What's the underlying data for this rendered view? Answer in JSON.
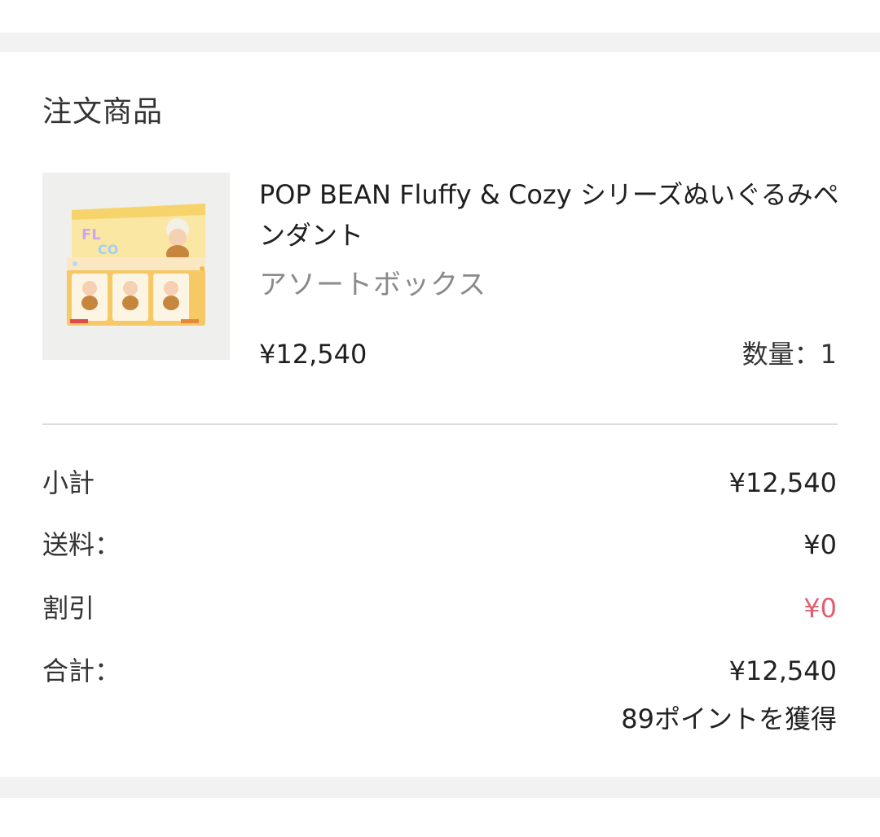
{
  "order": {
    "section_title": "注文商品",
    "item": {
      "name": "POP BEAN Fluffy & Cozy シリーズぬいぐるみペンダント",
      "variant": "アソートボックス",
      "price": "¥12,540",
      "quantity_label": "数量：1"
    }
  },
  "summary": {
    "subtotal_label": "小計",
    "subtotal_value": "¥12,540",
    "shipping_label": "送料：",
    "shipping_value": "¥0",
    "discount_label": "割引",
    "discount_value": "¥0",
    "total_label": "合計：",
    "total_value": "¥12,540",
    "points_text": "89ポイントを獲得"
  },
  "colors": {
    "discount": "#e35d6e",
    "divider": "#dcdcdc",
    "background": "#f2f2f2",
    "card": "#ffffff"
  }
}
